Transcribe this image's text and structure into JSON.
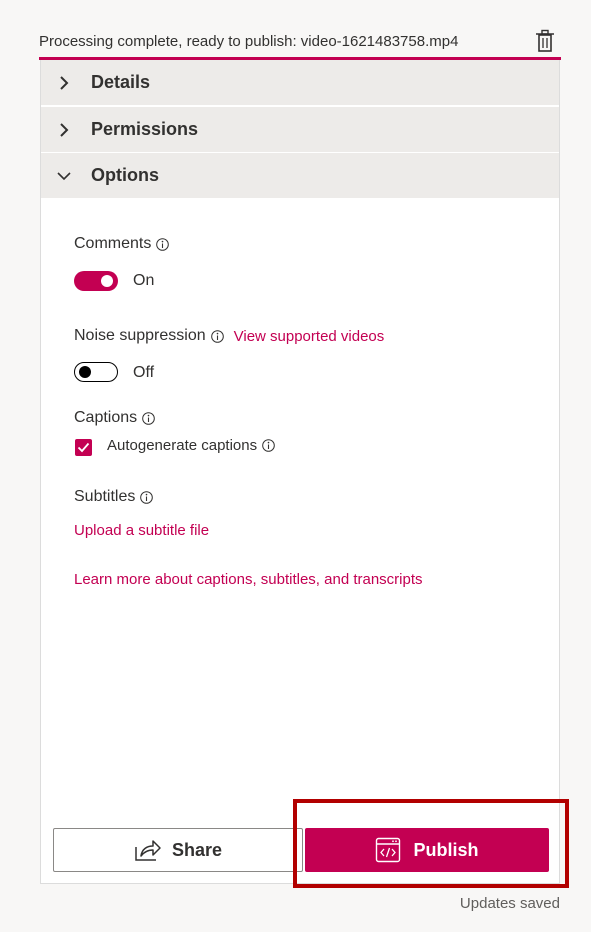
{
  "status": {
    "text": "Processing complete, ready to publish: video-1621483758.mp4",
    "delete_icon": "trash-icon"
  },
  "sections": {
    "details": {
      "label": "Details",
      "expanded": false
    },
    "permissions": {
      "label": "Permissions",
      "expanded": false
    },
    "options": {
      "label": "Options",
      "expanded": true
    }
  },
  "options": {
    "comments": {
      "label": "Comments",
      "state": true,
      "state_label": "On"
    },
    "noise": {
      "label": "Noise suppression",
      "link": "View supported videos",
      "state": false,
      "state_label": "Off"
    },
    "captions": {
      "label": "Captions",
      "checkbox_label": "Autogenerate captions",
      "checked": true
    },
    "subtitles": {
      "label": "Subtitles",
      "upload_link": "Upload a subtitle file"
    },
    "learn_more": "Learn more about captions, subtitles, and transcripts"
  },
  "footer": {
    "share_label": "Share",
    "publish_label": "Publish",
    "updates_status": "Updates saved"
  },
  "colors": {
    "accent": "#c30052",
    "highlight": "#b20000"
  }
}
